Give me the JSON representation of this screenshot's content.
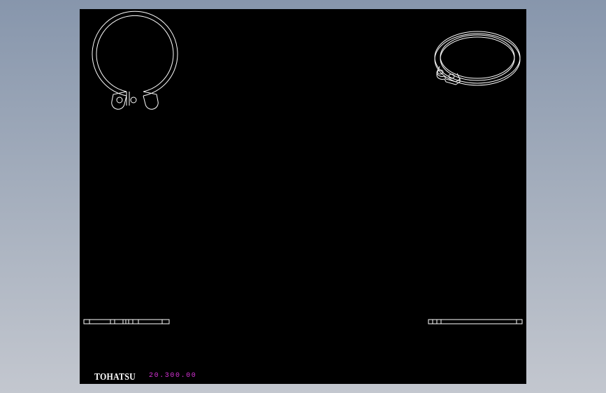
{
  "titleblock": {
    "brand": "TOHATSU",
    "part_number": "20.300.00"
  },
  "colors": {
    "background_top": "#8796ac",
    "background_bottom": "#c3c7cf",
    "sheet": "#000000",
    "line": "#ffffff",
    "part_number": "#d633d6"
  },
  "views": [
    "front-view",
    "isometric-view",
    "side-view-left",
    "side-view-right"
  ]
}
